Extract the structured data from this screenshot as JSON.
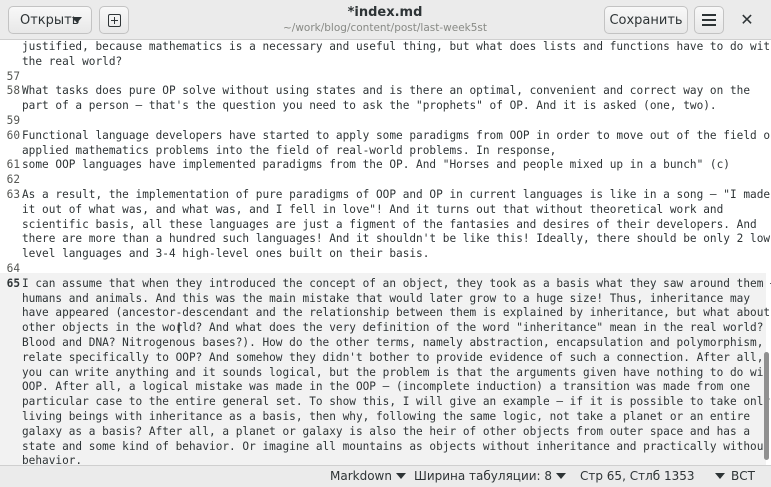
{
  "header": {
    "open_label": "Открыть",
    "title": "*index.md",
    "path": "~/work/blog/content/post/last-week5st",
    "save_label": "Сохранить",
    "close_glyph": "✕"
  },
  "icons": {
    "new_tab": "new-tab-icon",
    "menu": "hamburger-menu-icon",
    "close": "close-icon",
    "dropdown": "chevron-down-icon"
  },
  "editor": {
    "cursor_line": "65",
    "visual_lines": [
      {
        "n": "",
        "t": "justified, because mathematics is a necessary and useful thing, but what does lists and functions have to do with"
      },
      {
        "n": "",
        "t": "the real world?"
      },
      {
        "n": "57",
        "t": ""
      },
      {
        "n": "58",
        "t": "What tasks does pure OP solve without using states and is there an optimal, convenient and correct way on the"
      },
      {
        "n": "",
        "t": "part of a person — that's the question you need to ask the \"prophets\" of OP. And it is asked (one, two)."
      },
      {
        "n": "59",
        "t": ""
      },
      {
        "n": "60",
        "t": "Functional language developers have started to apply some paradigms from OOP in order to move out of the field of"
      },
      {
        "n": "",
        "t": "applied mathematics problems into the field of real-world problems. In response,"
      },
      {
        "n": "61",
        "t": "some OOP languages have implemented paradigms from the OP. And \"Horses and people mixed up in a bunch\" (c)"
      },
      {
        "n": "62",
        "t": ""
      },
      {
        "n": "63",
        "t": "As a result, the implementation of pure paradigms of OOP and OP in current languages is like in a song — \"I made"
      },
      {
        "n": "",
        "t": "it out of what was, and what was, and I fell in love\"! And it turns out that without theoretical work and"
      },
      {
        "n": "",
        "t": "scientific basis, all these languages are just a figment of the fantasies and desires of their developers. And"
      },
      {
        "n": "",
        "t": "there are more than a hundred such languages! And it shouldn't be like this! Ideally, there should be only 2 low-"
      },
      {
        "n": "",
        "t": "level languages and 3-4 high-level ones built on their basis."
      },
      {
        "n": "64",
        "t": ""
      },
      {
        "n": "65",
        "t": "I can assume that when they introduced the concept of an object, they took as a basis what they saw around them —"
      },
      {
        "n": "",
        "t": "humans and animals. And this was the main mistake that would later grow to a huge size! Thus, inheritance may"
      },
      {
        "n": "",
        "t": "have appeared (ancestor-descendant and the relationship between them is explained by inheritance, but what about"
      },
      {
        "n": "",
        "t": "other objects in the world? And what does the very definition of the word \"inheritance\" mean in the real world?"
      },
      {
        "n": "",
        "t": "Blood and DNA? Nitrogenous bases?). How do the other terms, namely abstraction, encapsulation and polymorphism,"
      },
      {
        "n": "",
        "t": "relate specifically to OOP? And somehow they didn't bother to provide evidence of such a connection. After all,"
      },
      {
        "n": "",
        "t": "you can write anything and it sounds logical, but the problem is that the arguments given have nothing to do with"
      },
      {
        "n": "",
        "t": "OOP. After all, a logical mistake was made in the OOP — (incomplete induction) a transition was made from one"
      },
      {
        "n": "",
        "t": "particular case to the entire general set. To show this, I will give an example — if it is possible to take only"
      },
      {
        "n": "",
        "t": "living beings with inheritance as a basis, then why, following the same logic, not take a planet or an entire"
      },
      {
        "n": "",
        "t": "galaxy as a basis? After all, a planet or galaxy is also the heir of other objects from outer space and has a"
      },
      {
        "n": "",
        "t": "state and some kind of behavior. Or imagine all mountains as objects without inheritance and practically without"
      },
      {
        "n": "",
        "t": "behavior."
      }
    ]
  },
  "status": {
    "language": "Markdown",
    "tab_width": "Ширина табуляции: 8",
    "position": "Стр 65, Стлб 1353",
    "insert_mode": "ВСТ"
  }
}
